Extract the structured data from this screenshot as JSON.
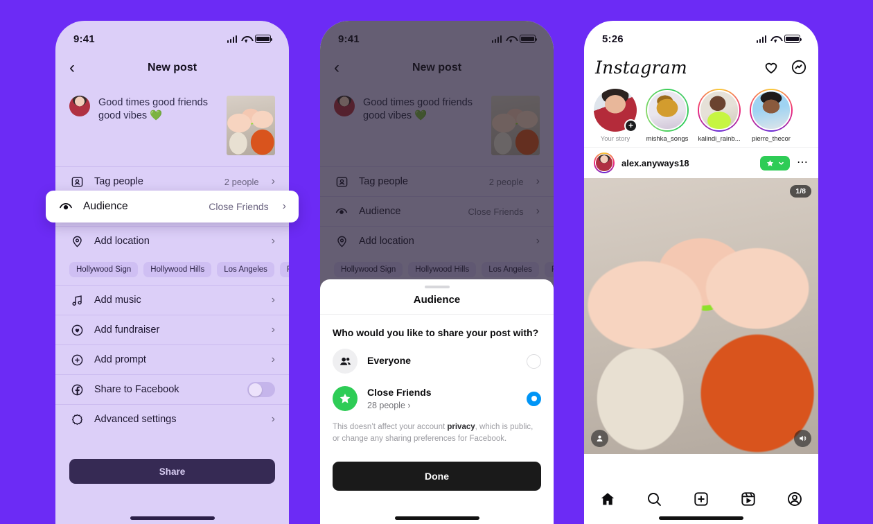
{
  "background_color": "#6C2BF5",
  "phone1": {
    "status": {
      "time": "9:41",
      "icons": [
        "signal-bars",
        "wifi",
        "battery"
      ]
    },
    "nav": {
      "back_icon": "chevron-left-icon",
      "title": "New post"
    },
    "composer": {
      "avatar": "user-avatar",
      "caption": "Good times good friends good vibes",
      "emoji": "💚",
      "thumbnail": "post-photo-thumbnail"
    },
    "rows": [
      {
        "icon": "tag-people-icon",
        "label": "Tag people",
        "value": "2 people",
        "chevron": "›"
      },
      {
        "icon": "location-pin-icon",
        "label": "Add location",
        "value": "",
        "chevron": "›"
      },
      {
        "icon": "music-note-icon",
        "label": "Add music",
        "value": "",
        "chevron": "›"
      },
      {
        "icon": "fundraiser-icon",
        "label": "Add fundraiser",
        "value": "",
        "chevron": "›"
      },
      {
        "icon": "plus-circle-icon",
        "label": "Add prompt",
        "value": "",
        "chevron": "›"
      },
      {
        "icon": "facebook-icon",
        "label": "Share to Facebook",
        "value": "",
        "chevron": ""
      },
      {
        "icon": "advanced-settings-icon",
        "label": "Advanced settings",
        "value": "",
        "chevron": "›"
      }
    ],
    "location_chips": [
      "Hollywood Sign",
      "Hollywood Hills",
      "Los Angeles",
      "R"
    ],
    "facebook_toggle": "off",
    "highlight": {
      "icon": "audience-eye-icon",
      "label": "Audience",
      "value": "Close Friends",
      "chevron": "›"
    },
    "share_button": "Share"
  },
  "phone2": {
    "status": {
      "time": "9:41"
    },
    "nav": {
      "back_icon": "chevron-left-icon",
      "title": "New post"
    },
    "composer": {
      "caption": "Good times good friends good vibes",
      "emoji": "💚"
    },
    "rows": [
      {
        "icon": "tag-people-icon",
        "label": "Tag people",
        "value": "2 people",
        "chevron": "›"
      },
      {
        "icon": "audience-eye-icon",
        "label": "Audience",
        "value": "Close Friends",
        "chevron": "›"
      },
      {
        "icon": "location-pin-icon",
        "label": "Add location",
        "value": "",
        "chevron": "›"
      }
    ],
    "location_chips": [
      "Hollywood Sign",
      "Hollywood Hills",
      "Los Angeles",
      "R"
    ],
    "sheet": {
      "grabber": "drag-handle",
      "title": "Audience",
      "question": "Who would you like to share your post with?",
      "options": [
        {
          "icon": "people-icon",
          "name": "Everyone",
          "sub": "",
          "selected": false
        },
        {
          "icon": "close-friends-star-icon",
          "name": "Close Friends",
          "sub": "28 people ›",
          "selected": true
        }
      ],
      "note_part1": "This doesn’t affect your account ",
      "note_link": "privacy",
      "note_part2": ", which is public, or change any sharing preferences for Facebook.",
      "done_button": "Done"
    }
  },
  "phone3": {
    "status": {
      "time": "5:26"
    },
    "header": {
      "logo": "Instagram",
      "icons": [
        "heart-icon",
        "messenger-icon"
      ]
    },
    "stories": [
      {
        "name": "Your story",
        "ring": "none",
        "badge": "+",
        "muted": true
      },
      {
        "name": "mishka_songs",
        "ring": "close-friends",
        "badge": "",
        "muted": false
      },
      {
        "name": "kalindi_rainb...",
        "ring": "gradient",
        "badge": "",
        "muted": false
      },
      {
        "name": "pierre_thecor",
        "ring": "gradient",
        "badge": "",
        "muted": false
      }
    ],
    "post": {
      "username": "alex.anyways18",
      "badge_icon": "close-friends-star-icon",
      "badge_chevron": "⌄",
      "more_icon": "more-options-icon",
      "carousel_indicator": "1/8",
      "tag_icon": "tagged-people-icon",
      "audio_icon": "speaker-icon"
    },
    "tabbar": [
      {
        "icon": "home-icon",
        "active": true
      },
      {
        "icon": "search-icon",
        "active": false
      },
      {
        "icon": "create-post-icon",
        "active": false
      },
      {
        "icon": "reels-icon",
        "active": false
      },
      {
        "icon": "profile-icon",
        "active": false
      }
    ]
  },
  "colors": {
    "background": "#6C2BF5",
    "phone1_bg": "#DCCFF8",
    "close_friends_green": "#2ECC56",
    "radio_blue": "#0095F6",
    "share_button": "#362A54",
    "done_button": "#1A1A1A"
  }
}
